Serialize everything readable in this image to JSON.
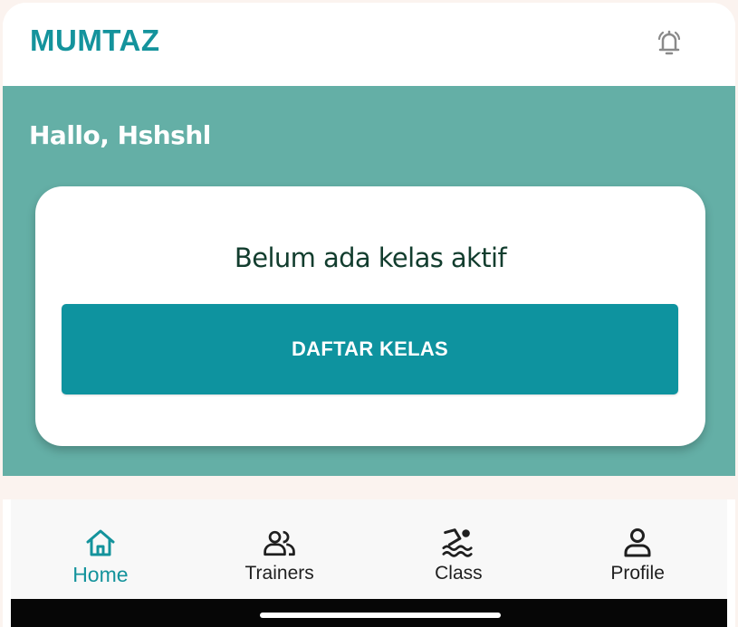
{
  "app": {
    "title": "MUMTAZ",
    "brand_color": "#14939c",
    "header_icon": "bell-icon"
  },
  "hero": {
    "greeting": "Hallo, Hshshl",
    "background": "#64afa6"
  },
  "card": {
    "message": "Belum ada kelas aktif",
    "button_label": "DAFTAR KELAS",
    "button_color": "#0e939f"
  },
  "bottom_nav": {
    "active": "Home",
    "items": [
      {
        "label": "Home",
        "icon": "home-icon"
      },
      {
        "label": "Trainers",
        "icon": "users-icon"
      },
      {
        "label": "Class",
        "icon": "swimmer-icon"
      },
      {
        "label": "Profile",
        "icon": "person-icon"
      }
    ]
  }
}
